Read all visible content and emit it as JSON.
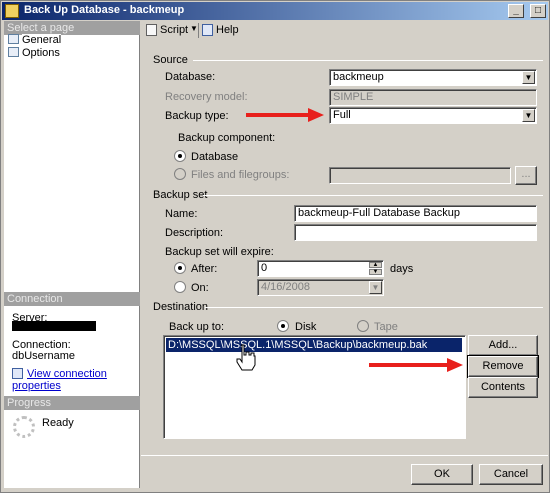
{
  "window": {
    "title": "Back Up Database - backmeup"
  },
  "left": {
    "select_page_header": "Select a page",
    "pages": [
      {
        "label": "General"
      },
      {
        "label": "Options"
      }
    ],
    "connection_header": "Connection",
    "server_label": "Server:",
    "connection_label": "Connection:",
    "connection_value": "dbUsername",
    "view_connection_link": "View connection properties",
    "progress_header": "Progress",
    "progress_status": "Ready"
  },
  "toolbar": {
    "script_label": "Script",
    "help_label": "Help"
  },
  "source": {
    "group_title": "Source",
    "database_label": "Database:",
    "database_value": "backmeup",
    "recovery_model_label": "Recovery model:",
    "recovery_model_value": "SIMPLE",
    "backup_type_label": "Backup type:",
    "backup_type_value": "Full",
    "backup_component_label": "Backup component:",
    "component_database": "Database",
    "component_files": "Files and filegroups:"
  },
  "backup_set": {
    "group_title": "Backup set",
    "name_label": "Name:",
    "name_value": "backmeup-Full Database Backup",
    "description_label": "Description:",
    "description_value": "",
    "expire_label": "Backup set will expire:",
    "after_label": "After:",
    "after_value": "0",
    "after_unit": "days",
    "on_label": "On:",
    "on_value": "4/16/2008"
  },
  "destination": {
    "group_title": "Destination",
    "back_up_to_label": "Back up to:",
    "disk_label": "Disk",
    "tape_label": "Tape",
    "paths": [
      "D:\\MSSQL\\MSSQL.1\\MSSQL\\Backup\\backmeup.bak"
    ],
    "add_label": "Add...",
    "remove_label": "Remove",
    "contents_label": "Contents"
  },
  "footer": {
    "ok_label": "OK",
    "cancel_label": "Cancel"
  },
  "colors": {
    "arrow": "#e8201c",
    "selection": "#0a246a"
  }
}
